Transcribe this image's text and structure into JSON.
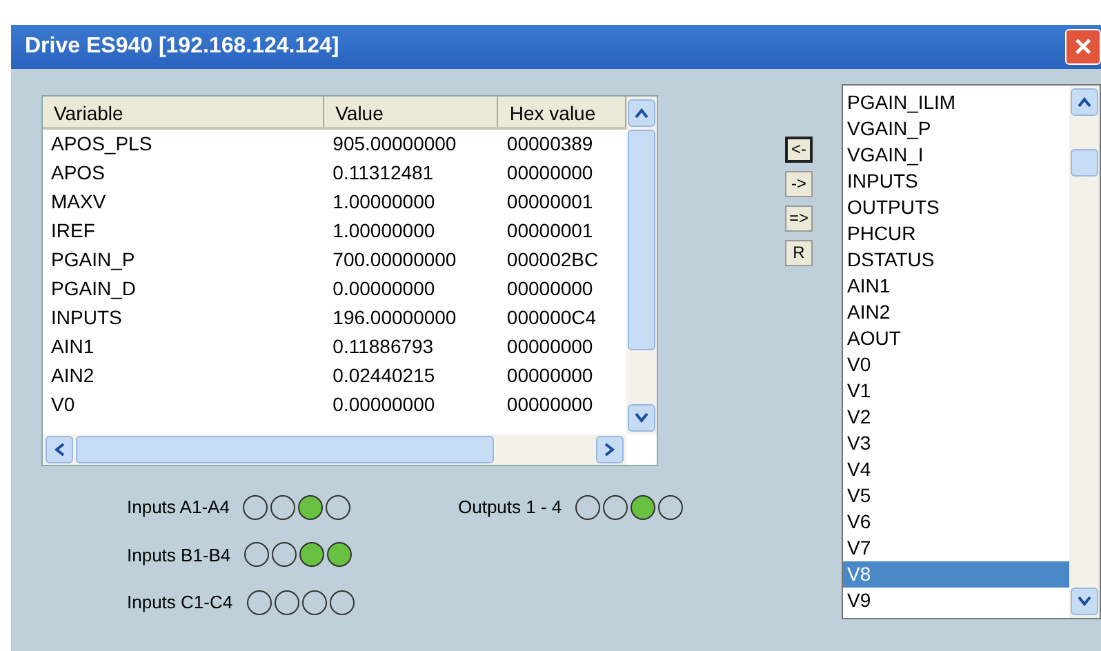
{
  "window": {
    "title": "Drive ES940 [192.168.124.124]",
    "close": "×"
  },
  "table": {
    "columns": [
      "Variable",
      "Value",
      "Hex value"
    ],
    "rows": [
      {
        "cells": [
          "APOS_PLS",
          "905.00000000",
          "00000389"
        ]
      },
      {
        "cells": [
          "APOS",
          "0.11312481",
          "00000000"
        ]
      },
      {
        "cells": [
          "MAXV",
          "1.00000000",
          "00000001"
        ]
      },
      {
        "cells": [
          "IREF",
          "1.00000000",
          "00000001"
        ]
      },
      {
        "cells": [
          "PGAIN_P",
          "700.00000000",
          "000002BC"
        ]
      },
      {
        "cells": [
          "PGAIN_D",
          "0.00000000",
          "00000000"
        ]
      },
      {
        "cells": [
          "INPUTS",
          "196.00000000",
          "000000C4"
        ]
      },
      {
        "cells": [
          "AIN1",
          "0.11886793",
          "00000000"
        ]
      },
      {
        "cells": [
          "AIN2",
          "0.02440215",
          "00000000"
        ]
      },
      {
        "cells": [
          "V0",
          "0.00000000",
          "00000000"
        ]
      }
    ]
  },
  "buttons": [
    {
      "label": "<-",
      "default": true
    },
    {
      "label": "->",
      "default": false
    },
    {
      "label": "=>",
      "default": false
    },
    {
      "label": "R",
      "default": false
    }
  ],
  "variable_list": [
    {
      "label": "PGAIN_ILIM",
      "selected": false
    },
    {
      "label": "VGAIN_P",
      "selected": false
    },
    {
      "label": "VGAIN_I",
      "selected": false
    },
    {
      "label": "INPUTS",
      "selected": false
    },
    {
      "label": "OUTPUTS",
      "selected": false
    },
    {
      "label": "PHCUR",
      "selected": false
    },
    {
      "label": "DSTATUS",
      "selected": false
    },
    {
      "label": "AIN1",
      "selected": false
    },
    {
      "label": "AIN2",
      "selected": false
    },
    {
      "label": "AOUT",
      "selected": false
    },
    {
      "label": "V0",
      "selected": false
    },
    {
      "label": "V1",
      "selected": false
    },
    {
      "label": "V2",
      "selected": false
    },
    {
      "label": "V3",
      "selected": false
    },
    {
      "label": "V4",
      "selected": false
    },
    {
      "label": "V5",
      "selected": false
    },
    {
      "label": "V6",
      "selected": false
    },
    {
      "label": "V7",
      "selected": false
    },
    {
      "label": "V8",
      "selected": true
    },
    {
      "label": "V9",
      "selected": false
    }
  ],
  "io_groups": [
    {
      "label": "Inputs A1-A4",
      "leds": [
        {
          "on": false
        },
        {
          "on": false
        },
        {
          "on": true
        },
        {
          "on": false
        }
      ]
    },
    {
      "label": "Outputs 1 - 4",
      "leds": [
        {
          "on": false
        },
        {
          "on": false
        },
        {
          "on": true
        },
        {
          "on": false
        }
      ]
    },
    {
      "label": "Inputs B1-B4",
      "leds": [
        {
          "on": false
        },
        {
          "on": false
        },
        {
          "on": true
        },
        {
          "on": true
        }
      ]
    },
    {
      "label": "Inputs C1-C4",
      "leds": [
        {
          "on": false
        },
        {
          "on": false
        },
        {
          "on": false
        },
        {
          "on": false
        }
      ]
    }
  ]
}
